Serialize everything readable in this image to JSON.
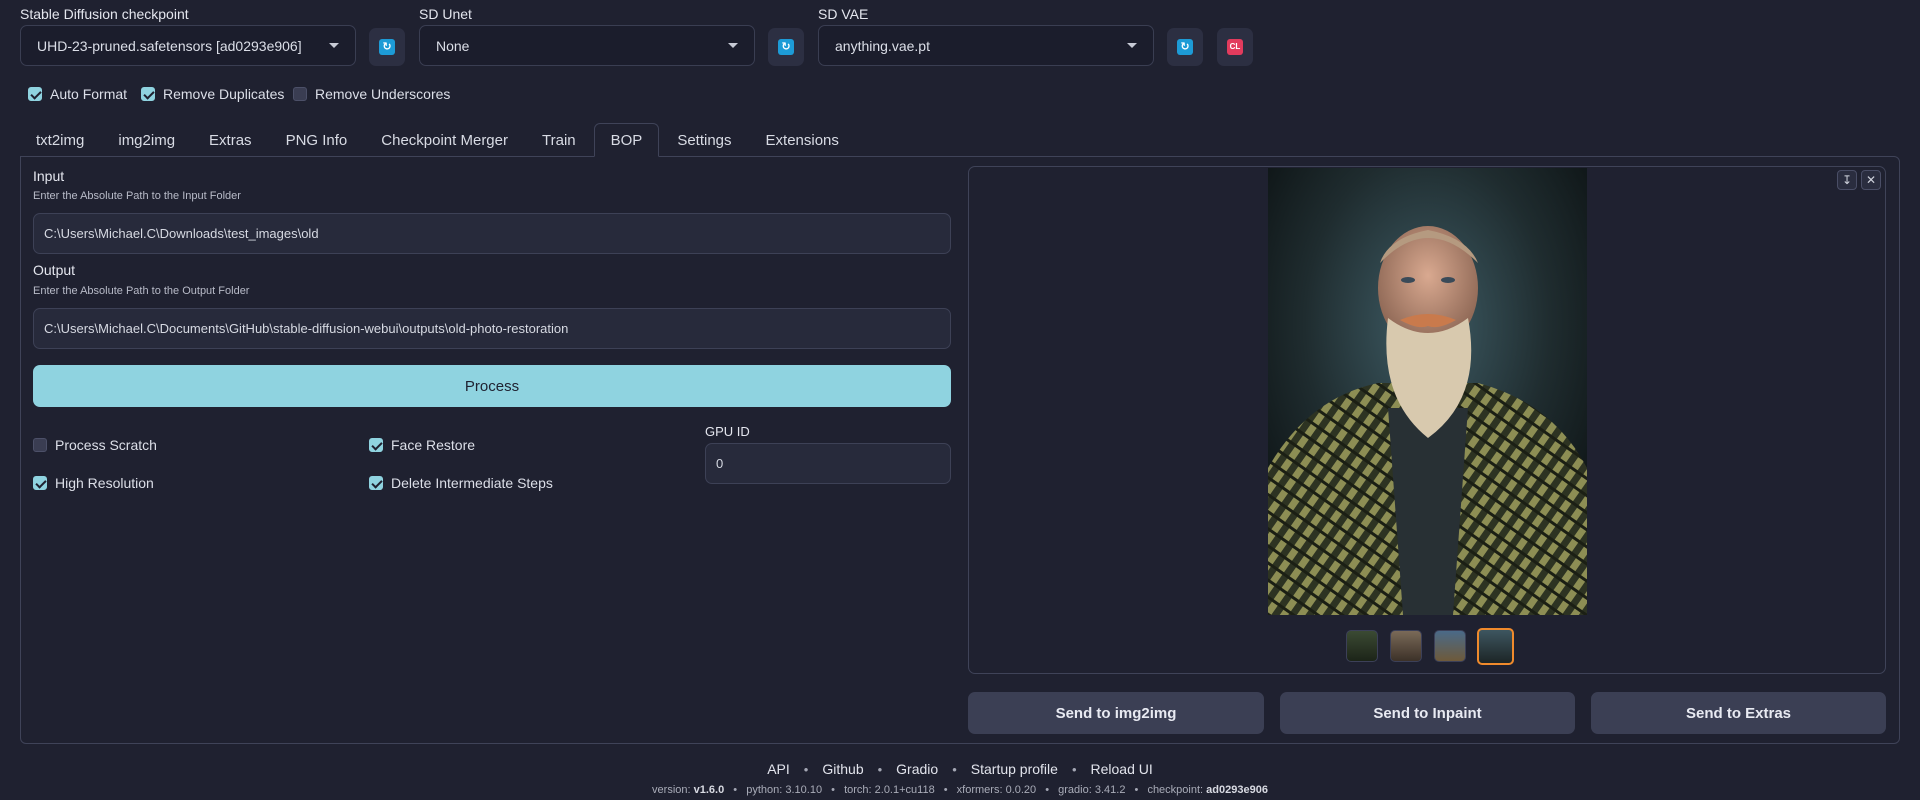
{
  "top": {
    "checkpoint": {
      "label": "Stable Diffusion checkpoint",
      "value": "UHD-23-pruned.safetensors [ad0293e906]"
    },
    "unet": {
      "label": "SD Unet",
      "value": "None"
    },
    "vae": {
      "label": "SD VAE",
      "value": "anything.vae.pt"
    },
    "cl_label": "CL"
  },
  "options": [
    {
      "label": "Auto Format",
      "checked": true
    },
    {
      "label": "Remove Duplicates",
      "checked": true
    },
    {
      "label": "Remove Underscores",
      "checked": false
    }
  ],
  "tabs": [
    "txt2img",
    "img2img",
    "Extras",
    "PNG Info",
    "Checkpoint Merger",
    "Train",
    "BOP",
    "Settings",
    "Extensions"
  ],
  "active_tab": "BOP",
  "bop": {
    "input_label": "Input",
    "input_hint": "Enter the Absolute Path to the Input Folder",
    "input_value": "C:\\Users\\Michael.C\\Downloads\\test_images\\old",
    "output_label": "Output",
    "output_hint": "Enter the Absolute Path to the Output Folder",
    "output_value": "C:\\Users\\Michael.C\\Documents\\GitHub\\stable-diffusion-webui\\outputs\\old-photo-restoration",
    "process_label": "Process",
    "process_scratch": "Process Scratch",
    "high_resolution": "High Resolution",
    "face_restore": "Face Restore",
    "delete_steps": "Delete Intermediate Steps",
    "gpu_label": "GPU ID",
    "gpu_value": "0"
  },
  "gallery": {
    "send_img2img": "Send to img2img",
    "send_inpaint": "Send to Inpaint",
    "send_extras": "Send to Extras"
  },
  "footer": {
    "links": [
      "API",
      "Github",
      "Gradio",
      "Startup profile",
      "Reload UI"
    ],
    "version_label": "version:",
    "version": "v1.6.0",
    "python_label": "python:",
    "python": "3.10.10",
    "torch_label": "torch:",
    "torch": "2.0.1+cu118",
    "xformers_label": "xformers:",
    "xformers": "0.0.20",
    "gradio_label": "gradio:",
    "gradio": "3.41.2",
    "checkpoint_label": "checkpoint:",
    "checkpoint": "ad0293e906"
  },
  "colors": {
    "accent": "#8fd3e0",
    "background": "#1f2130",
    "selected_thumb_border": "#f08a2c"
  }
}
